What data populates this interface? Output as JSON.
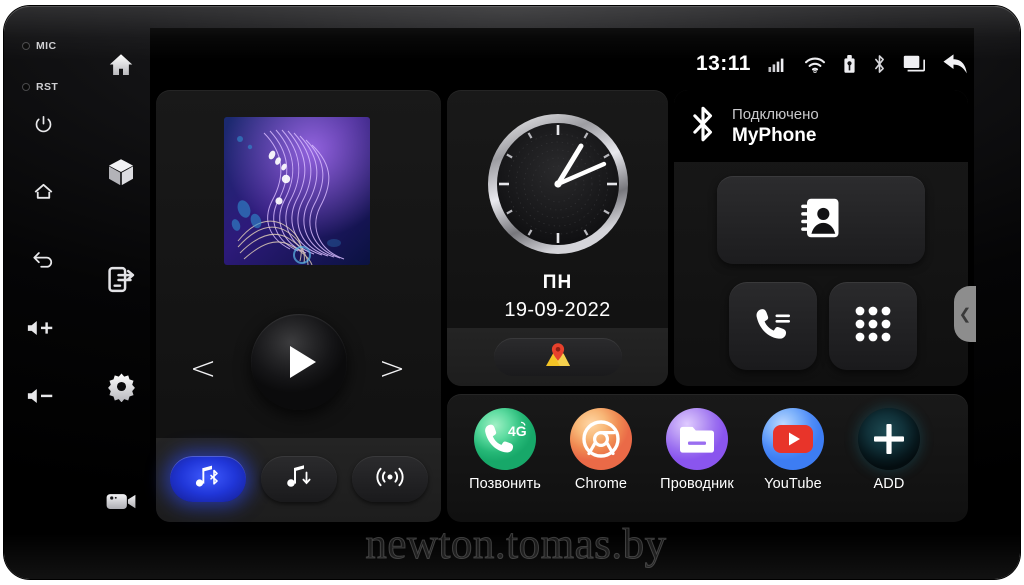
{
  "device": {
    "hardware_labels": [
      {
        "name": "mic",
        "text": "MIC"
      },
      {
        "name": "reset",
        "text": "RST"
      }
    ],
    "hardware_buttons": [
      {
        "name": "power-button",
        "icon": "power-icon"
      },
      {
        "name": "home-hard-button",
        "icon": "home-outline-icon"
      },
      {
        "name": "back-hard-button",
        "icon": "back-arrow-icon"
      },
      {
        "name": "volume-up-button",
        "icon": "volume-up-icon"
      },
      {
        "name": "volume-down-button",
        "icon": "volume-down-icon"
      }
    ]
  },
  "sidebar": {
    "items": [
      {
        "name": "sidebar-item-home",
        "icon": "home-icon"
      },
      {
        "name": "sidebar-item-apps",
        "icon": "cube-icon"
      },
      {
        "name": "sidebar-item-screen-mirror",
        "icon": "phone-link-icon"
      },
      {
        "name": "sidebar-item-settings",
        "icon": "gear-icon"
      },
      {
        "name": "sidebar-item-dashcam",
        "icon": "video-camera-icon"
      }
    ]
  },
  "statusbar": {
    "time": "13:11",
    "icons": [
      {
        "name": "signal-icon",
        "label": "signal"
      },
      {
        "name": "wifi-icon",
        "label": "wifi"
      },
      {
        "name": "usb-icon",
        "label": "usb"
      },
      {
        "name": "bluetooth-icon",
        "label": "bluetooth"
      },
      {
        "name": "recents-icon",
        "label": "recents"
      },
      {
        "name": "back-icon",
        "label": "back"
      }
    ]
  },
  "media": {
    "album_art": "abstract-wave-artwork",
    "prev_label": "<",
    "next_label": ">",
    "play_state": "play",
    "sources": [
      {
        "name": "source-bluetooth-music",
        "icon": "music-bluetooth-icon",
        "active": true
      },
      {
        "name": "source-usb-music",
        "icon": "music-usb-icon",
        "active": false
      },
      {
        "name": "source-radio",
        "icon": "radio-waves-icon",
        "active": false
      }
    ]
  },
  "clock_widget": {
    "day": "ПН",
    "date": "19-09-2022",
    "analog_time": {
      "hour": 13,
      "minute": 11
    },
    "maps_button": {
      "name": "maps-button",
      "icon": "map-pin-icon"
    }
  },
  "bluetooth_widget": {
    "icon": "bluetooth-icon",
    "status": "Подключено",
    "device_name": "MyPhone",
    "buttons": [
      {
        "name": "bt-contacts-button",
        "icon": "contacts-book-icon"
      },
      {
        "name": "bt-call-log-button",
        "icon": "call-log-icon"
      },
      {
        "name": "bt-dialpad-button",
        "icon": "dialpad-icon"
      }
    ]
  },
  "dock": {
    "apps": [
      {
        "name": "app-pozvonit",
        "label": "Позвонить",
        "icon": "phone-4g-icon",
        "badge": "4G"
      },
      {
        "name": "app-chrome",
        "label": "Chrome",
        "icon": "chrome-icon"
      },
      {
        "name": "app-provodnik",
        "label": "Проводник",
        "icon": "folder-icon"
      },
      {
        "name": "app-youtube",
        "label": "YouTube",
        "icon": "youtube-icon"
      },
      {
        "name": "app-add",
        "label": "ADD",
        "icon": "plus-icon"
      }
    ]
  },
  "edge_tab": {
    "name": "edge-pull-tab",
    "icon": "chevron-left-icon",
    "glyph": "❮"
  },
  "watermark": {
    "text": "newton.tomas.by"
  }
}
